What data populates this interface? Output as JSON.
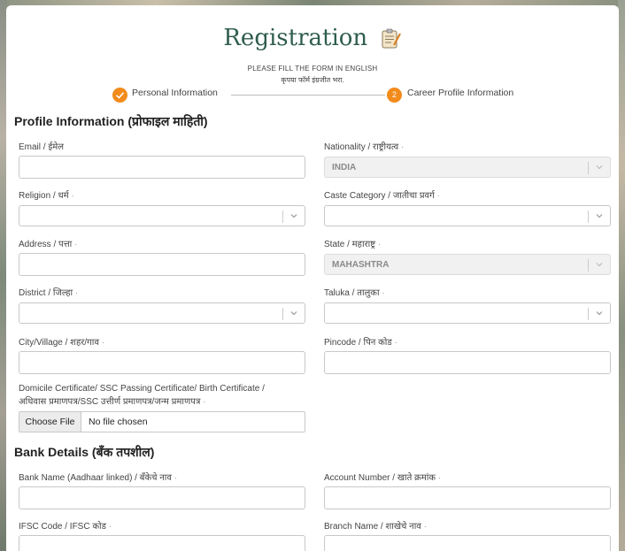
{
  "header": {
    "title": "Registration",
    "note_en": "PLEASE FILL THE FORM IN ENGLISH",
    "note_mr": "कृपया फॉर्म इंग्रजीत भरा."
  },
  "stepper": {
    "step1_label": "Personal Information",
    "step1_icon": "check-icon",
    "step2_number": "2",
    "step2_label": "Career Profile Information",
    "accent": "#f28b1c"
  },
  "profile": {
    "section_title": "Profile Information (प्रोफाइल माहिती)",
    "email_label": "Email / ईमेल",
    "nationality_label": "Nationality / राष्ट्रीयत्व",
    "nationality_value": "INDIA",
    "religion_label": "Religion / धर्म",
    "caste_label": "Caste Category / जातीचा प्रवर्ग",
    "address_label": "Address / पत्ता",
    "state_label": "State / महाराष्ट्र",
    "state_value": "MAHASHTRA",
    "district_label": "District / जिल्हा",
    "taluka_label": "Taluka / तालुका",
    "city_label": "City/Village / शहर/गाव",
    "pincode_label": "Pincode / पिन कोड",
    "domicile_label_1": "Domicile Certificate/ SSC Passing Certificate/ Birth Certificate /",
    "domicile_label_2": "अधिवास प्रमाणपत्र/SSC उत्तीर्ण प्रमाणपत्र/जन्म प्रमाणपत्र",
    "file_button": "Choose File",
    "file_status": "No file chosen",
    "required_mark": "·"
  },
  "bank": {
    "section_title": "Bank Details (बँक तपशील)",
    "bank_name_label": "Bank Name (Aadhaar linked) / बँकेचे नाव",
    "account_label": "Account Number / खाते क्रमांक",
    "ifsc_label": "IFSC Code / IFSC कोड",
    "branch_label": "Branch Name / शाखेचे नाव"
  }
}
